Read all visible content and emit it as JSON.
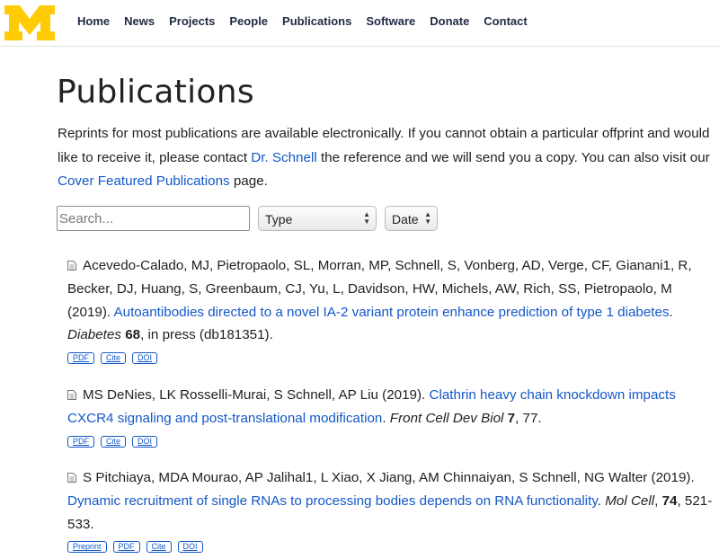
{
  "nav": {
    "logo_letter": "M",
    "items": [
      "Home",
      "News",
      "Projects",
      "People",
      "Publications",
      "Software",
      "Donate",
      "Contact"
    ]
  },
  "page": {
    "title": "Publications",
    "intro_before_contact": "Reprints for most publications are available electronically. If you cannot obtain a particular offprint and would like to receive it, please contact ",
    "contact_link": "Dr. Schnell",
    "intro_middle": " the reference and we will send you a copy. You can also visit our ",
    "cover_link": "Cover Featured Publications",
    "intro_end": " page."
  },
  "filters": {
    "search_placeholder": "Search...",
    "type_label": "Type",
    "date_label": "Date"
  },
  "publications": [
    {
      "authors_year": "Acevedo-Calado, MJ, Pietropaolo, SL, Morran, MP, Schnell, S, Vonberg, AD, Verge, CF, Gianani1, R, Becker, DJ, Huang, S, Greenbaum, CJ, Yu, L, Davidson, HW, Michels, AW, Rich, SS, Pietropaolo, M (2019). ",
      "title": "Autoantibodies directed to a novel IA-2 variant protein enhance prediction of type 1 diabetes",
      "after_title": ". ",
      "journal": "Diabetes",
      "volume": "68",
      "pages": ", in press (db181351).",
      "badges": [
        "PDF",
        "Cite",
        "DOI"
      ]
    },
    {
      "authors_year": "MS DeNies, LK Rosselli-Murai, S Schnell, AP Liu (2019). ",
      "title": "Clathrin heavy chain knockdown impacts CXCR4 signaling and post-translational modification",
      "after_title": ". ",
      "journal": "Front Cell Dev Biol",
      "volume": "7",
      "pages": ", 77.",
      "badges": [
        "PDF",
        "Cite",
        "DOI"
      ]
    },
    {
      "authors_year": "S Pitchiaya, MDA Mourao, AP Jalihal1, L Xiao, X Jiang, AM Chinnaiyan, S Schnell, NG Walter (2019). ",
      "title": "Dynamic recruitment of single RNAs to processing bodies depends on RNA functionality",
      "after_title": ". ",
      "journal": "Mol Cell",
      "volume": "74",
      "pages": ", 521-533.",
      "badges": [
        "Preprint",
        "PDF",
        "Cite",
        "DOI"
      ]
    }
  ],
  "colors": {
    "brand_maize": "#ffcb05",
    "nav_text": "#1f2a44",
    "link": "#1458c9"
  }
}
